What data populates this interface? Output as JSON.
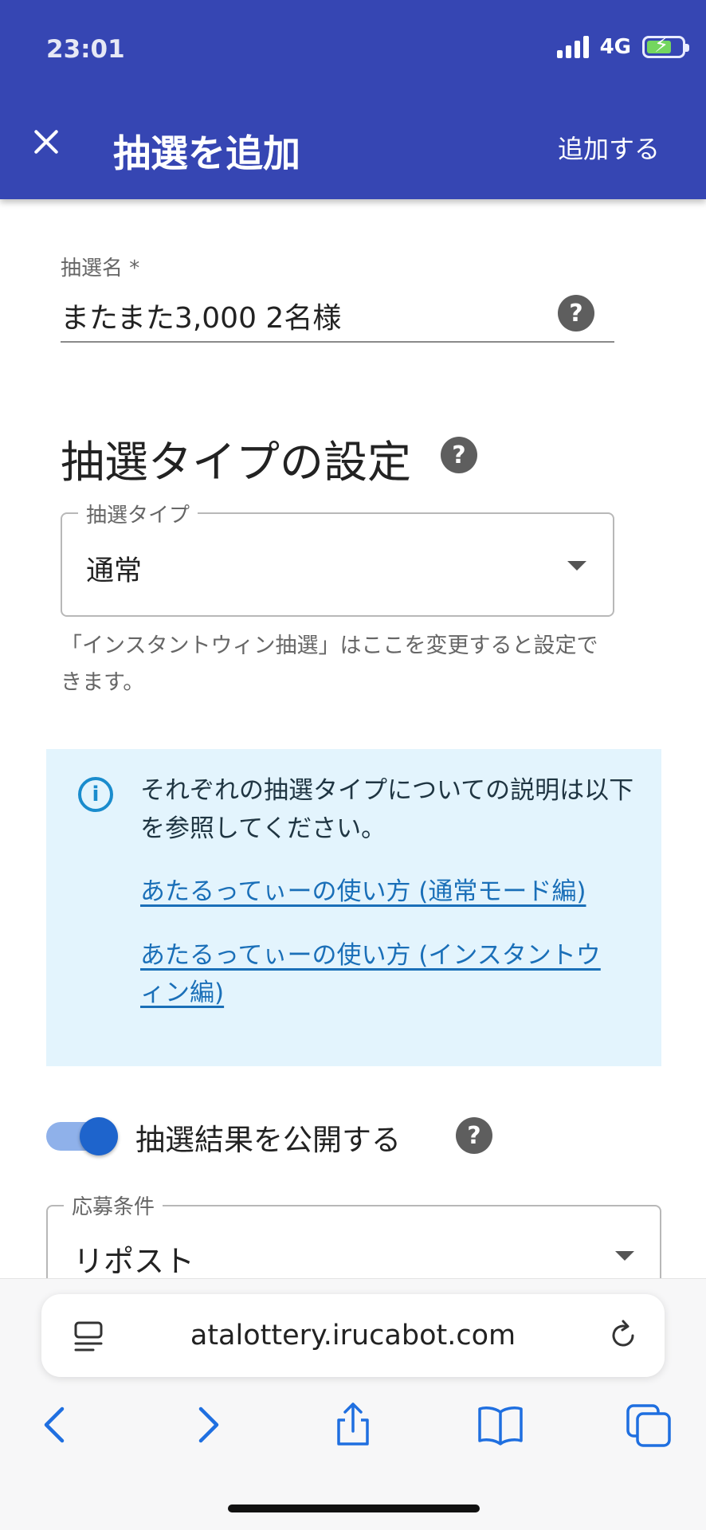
{
  "status": {
    "time": "23:01",
    "network": "4G"
  },
  "appbar": {
    "title": "抽選を追加",
    "action": "追加する"
  },
  "lottery_name": {
    "label": "抽選名 *",
    "value": "またまた3,000 2名様"
  },
  "type_section": {
    "title": "抽選タイプの設定",
    "select_label": "抽選タイプ",
    "select_value": "通常",
    "hint": "「インスタントウィン抽選」はここを変更すると設定できます。"
  },
  "info": {
    "text": "それぞれの抽選タイプについての説明は以下を参照してください。",
    "link1": "あたるってぃーの使い方 (通常モード編)",
    "link2": "あたるってぃーの使い方 (インスタントウィン編)"
  },
  "publish_toggle": {
    "label": "抽選結果を公開する",
    "checked": true
  },
  "condition": {
    "label": "応募条件",
    "value": "リポスト"
  },
  "browser": {
    "url": "atalottery.irucabot.com"
  },
  "help_glyph": "?",
  "info_glyph": "i",
  "colors": {
    "appbar": "#3646b3",
    "link": "#1a6fb8",
    "info_bg": "#e3f4fd",
    "toggle": "#1e64cc"
  }
}
